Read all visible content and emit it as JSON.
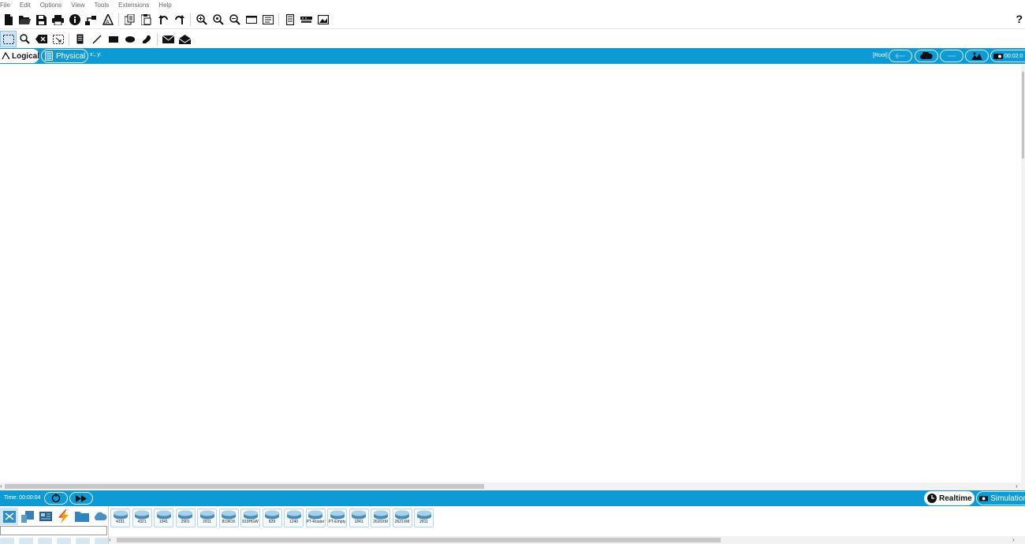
{
  "menu": [
    "File",
    "Edit",
    "Options",
    "View",
    "Tools",
    "Extensions",
    "Help"
  ],
  "toolbar": {
    "buttons": [
      "new-file-icon",
      "open-folder-icon",
      "save-icon",
      "print-icon",
      "info-icon",
      "network-wizard-icon",
      "activity-wizard-icon",
      "copy-icon",
      "paste-icon",
      "undo-icon",
      "redo-icon",
      "zoom-in-icon",
      "zoom-reset-icon",
      "zoom-out-icon",
      "drawing-palette-icon",
      "custom-device-dialog-icon",
      "viewport-icon",
      "cluster-icon",
      "physical-workspace-icon"
    ],
    "help": "?"
  },
  "tools": [
    "select-icon",
    "inspect-icon",
    "delete-icon",
    "resize-icon",
    "note-icon",
    "line-icon",
    "rectangle-icon",
    "ellipse-icon",
    "freeform-icon",
    "simple-pdu-icon",
    "complex-pdu-icon"
  ],
  "viewbar": {
    "logical_label": "Logical",
    "physical_label": "Physical",
    "xy": "x:, y:",
    "root": "[Root]",
    "time": "00:02:0"
  },
  "statusbar": {
    "time": "Time: 00:00:04",
    "realtime_label": "Realtime",
    "simulation_label": "Simulation"
  },
  "devices": [
    "4331",
    "4321",
    "1941",
    "2901",
    "2911",
    "819IOX",
    "819HGW",
    "829",
    "1240",
    "PT-Router",
    "PT-Empty",
    "1841",
    "2620XM",
    "2621XM",
    "2811"
  ],
  "colors": {
    "accent_blue": "#0e9ad5",
    "active_tool": "#cfe6f6"
  }
}
